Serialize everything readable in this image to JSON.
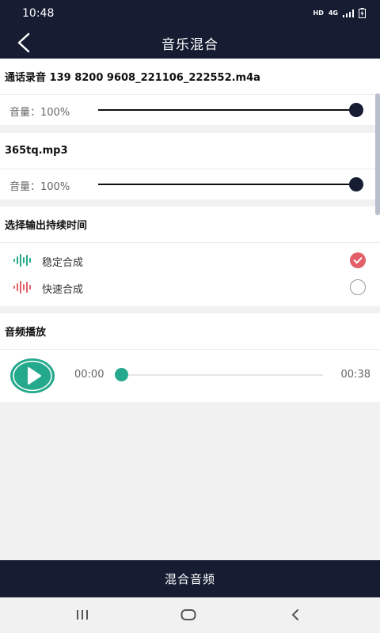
{
  "status_bar": {
    "time": "10:48",
    "hd": "HD",
    "network": "4G"
  },
  "header": {
    "title": "音乐混合"
  },
  "track1": {
    "name": "通话录音 139 8200 9608_221106_222552.m4a",
    "volume_label": "音量：100%",
    "volume": 1.0
  },
  "track2": {
    "name": "365tq.mp3",
    "volume_label": "音量：100%",
    "volume": 1.0
  },
  "duration": {
    "heading": "选择输出持续时间",
    "options": [
      {
        "label": "稳定合成",
        "selected": true
      },
      {
        "label": "快速合成",
        "selected": false
      }
    ]
  },
  "player": {
    "heading": "音频播放",
    "current_time": "00:00",
    "total_time": "00:38",
    "progress": 0.0
  },
  "action": {
    "mix_label": "混合音频"
  },
  "colors": {
    "primary": "#161d33",
    "accent_green": "#24a98c",
    "accent_red": "#e36068"
  }
}
